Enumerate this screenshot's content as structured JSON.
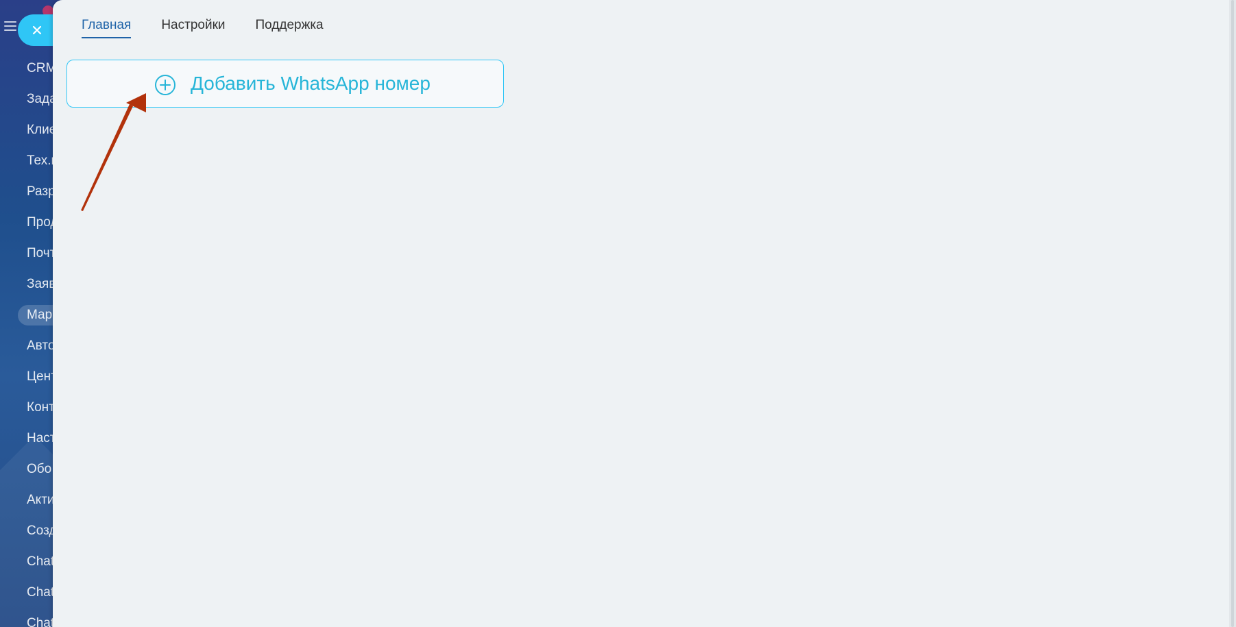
{
  "sidebar": {
    "items": [
      {
        "label": "CRM"
      },
      {
        "label": "Зада"
      },
      {
        "label": "Клие"
      },
      {
        "label": "Тех.п"
      },
      {
        "label": "Разр"
      },
      {
        "label": "Прод"
      },
      {
        "label": "Почт"
      },
      {
        "label": "Заяв"
      },
      {
        "label": "Мар",
        "active": true
      },
      {
        "label": "Авто"
      },
      {
        "label": "Цент"
      },
      {
        "label": "Конт"
      },
      {
        "label": "Наст"
      },
      {
        "label": "Обо"
      },
      {
        "label": "Акти"
      },
      {
        "label": "Созд"
      },
      {
        "label": "Chat"
      },
      {
        "label": "Chat"
      },
      {
        "label": "Chat"
      }
    ]
  },
  "slider": {
    "tabs": [
      {
        "label": "Главная",
        "active": true
      },
      {
        "label": "Настройки"
      },
      {
        "label": "Поддержка"
      }
    ],
    "add_button": {
      "label": "Добавить WhatsApp номер",
      "icon": "plus-circle-icon"
    }
  },
  "colors": {
    "accent": "#2fc6f6",
    "active_tab": "#1e63a8",
    "button_text": "#27b5d8",
    "annotation_arrow": "#b2320b"
  }
}
